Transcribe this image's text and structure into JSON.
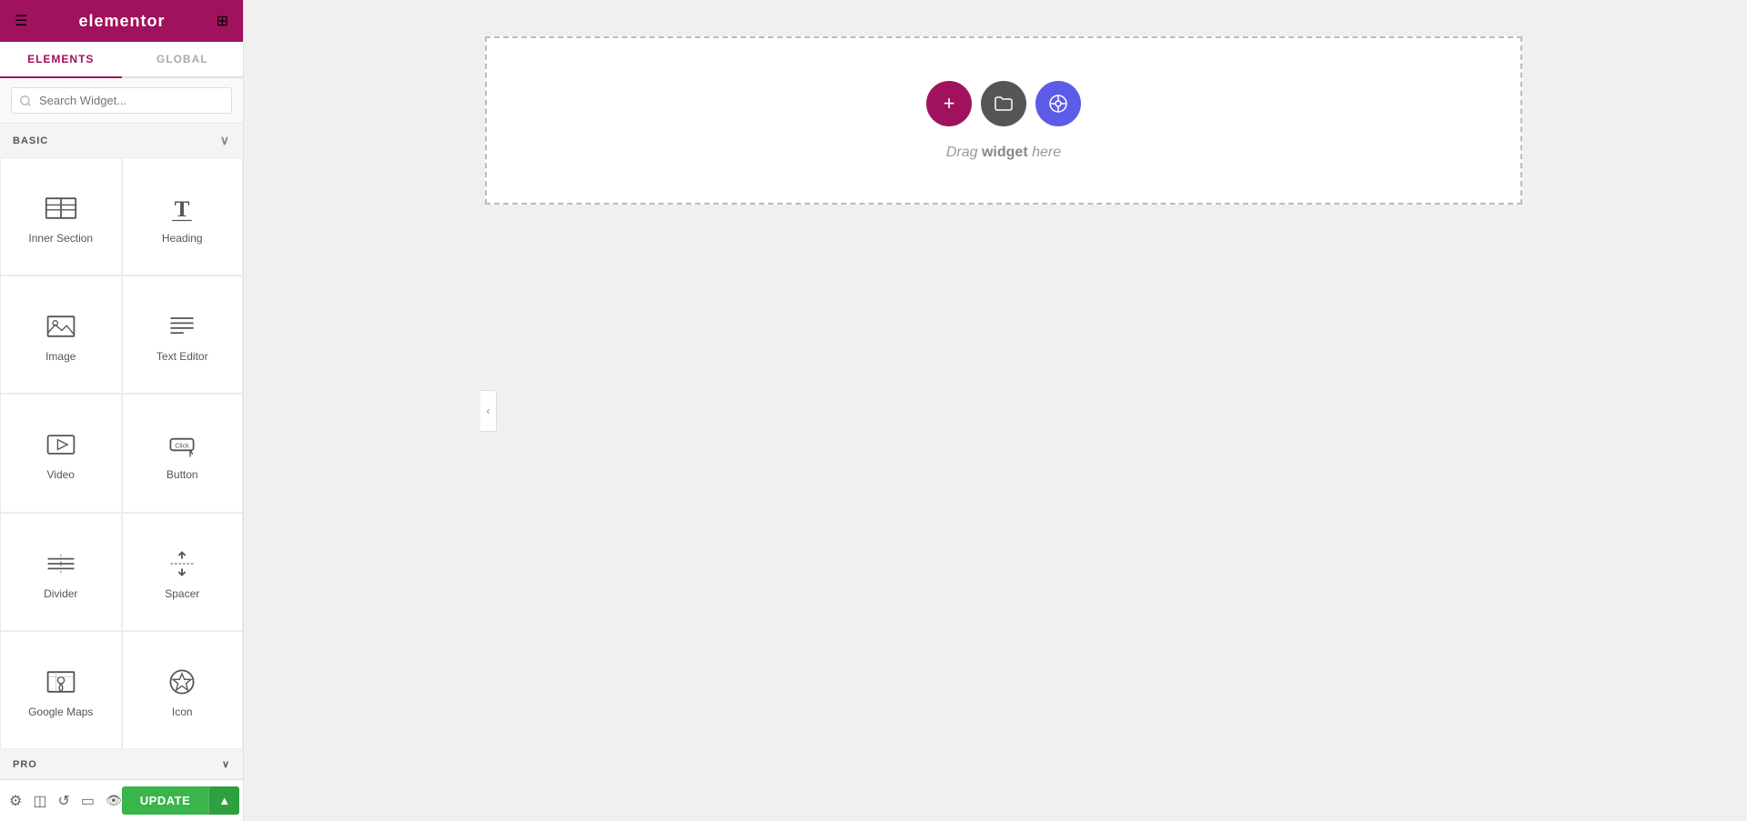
{
  "topbar": {
    "logo": "elementor",
    "hamburger_icon": "☰",
    "grid_icon": "⊞"
  },
  "tabs": [
    {
      "id": "elements",
      "label": "ELEMENTS",
      "active": true
    },
    {
      "id": "global",
      "label": "GLOBAL",
      "active": false
    }
  ],
  "search": {
    "placeholder": "Search Widget..."
  },
  "basic_section": {
    "label": "BASIC",
    "collapsed": false
  },
  "widgets": [
    {
      "id": "inner-section",
      "label": "Inner Section",
      "icon": "inner-section"
    },
    {
      "id": "heading",
      "label": "Heading",
      "icon": "heading"
    },
    {
      "id": "image",
      "label": "Image",
      "icon": "image"
    },
    {
      "id": "text-editor",
      "label": "Text Editor",
      "icon": "text-editor"
    },
    {
      "id": "video",
      "label": "Video",
      "icon": "video"
    },
    {
      "id": "button",
      "label": "Button",
      "icon": "button"
    },
    {
      "id": "divider",
      "label": "Divider",
      "icon": "divider"
    },
    {
      "id": "spacer",
      "label": "Spacer",
      "icon": "spacer"
    },
    {
      "id": "google-maps",
      "label": "Google Maps",
      "icon": "google-maps"
    },
    {
      "id": "icon",
      "label": "Icon",
      "icon": "icon"
    }
  ],
  "pro_section": {
    "label": "PRO",
    "collapsed": true
  },
  "bottom_toolbar": {
    "settings_icon": "⚙",
    "layers_icon": "◫",
    "history_icon": "↺",
    "responsive_icon": "□",
    "preview_icon": "👁",
    "update_label": "UPDATE",
    "update_arrow": "▲"
  },
  "canvas": {
    "drop_zone": {
      "label": "Drag widget here",
      "label_bold": "widget"
    },
    "add_btn_title": "Add Element",
    "folder_btn_title": "My Templates",
    "template_btn_title": "Template Library"
  }
}
